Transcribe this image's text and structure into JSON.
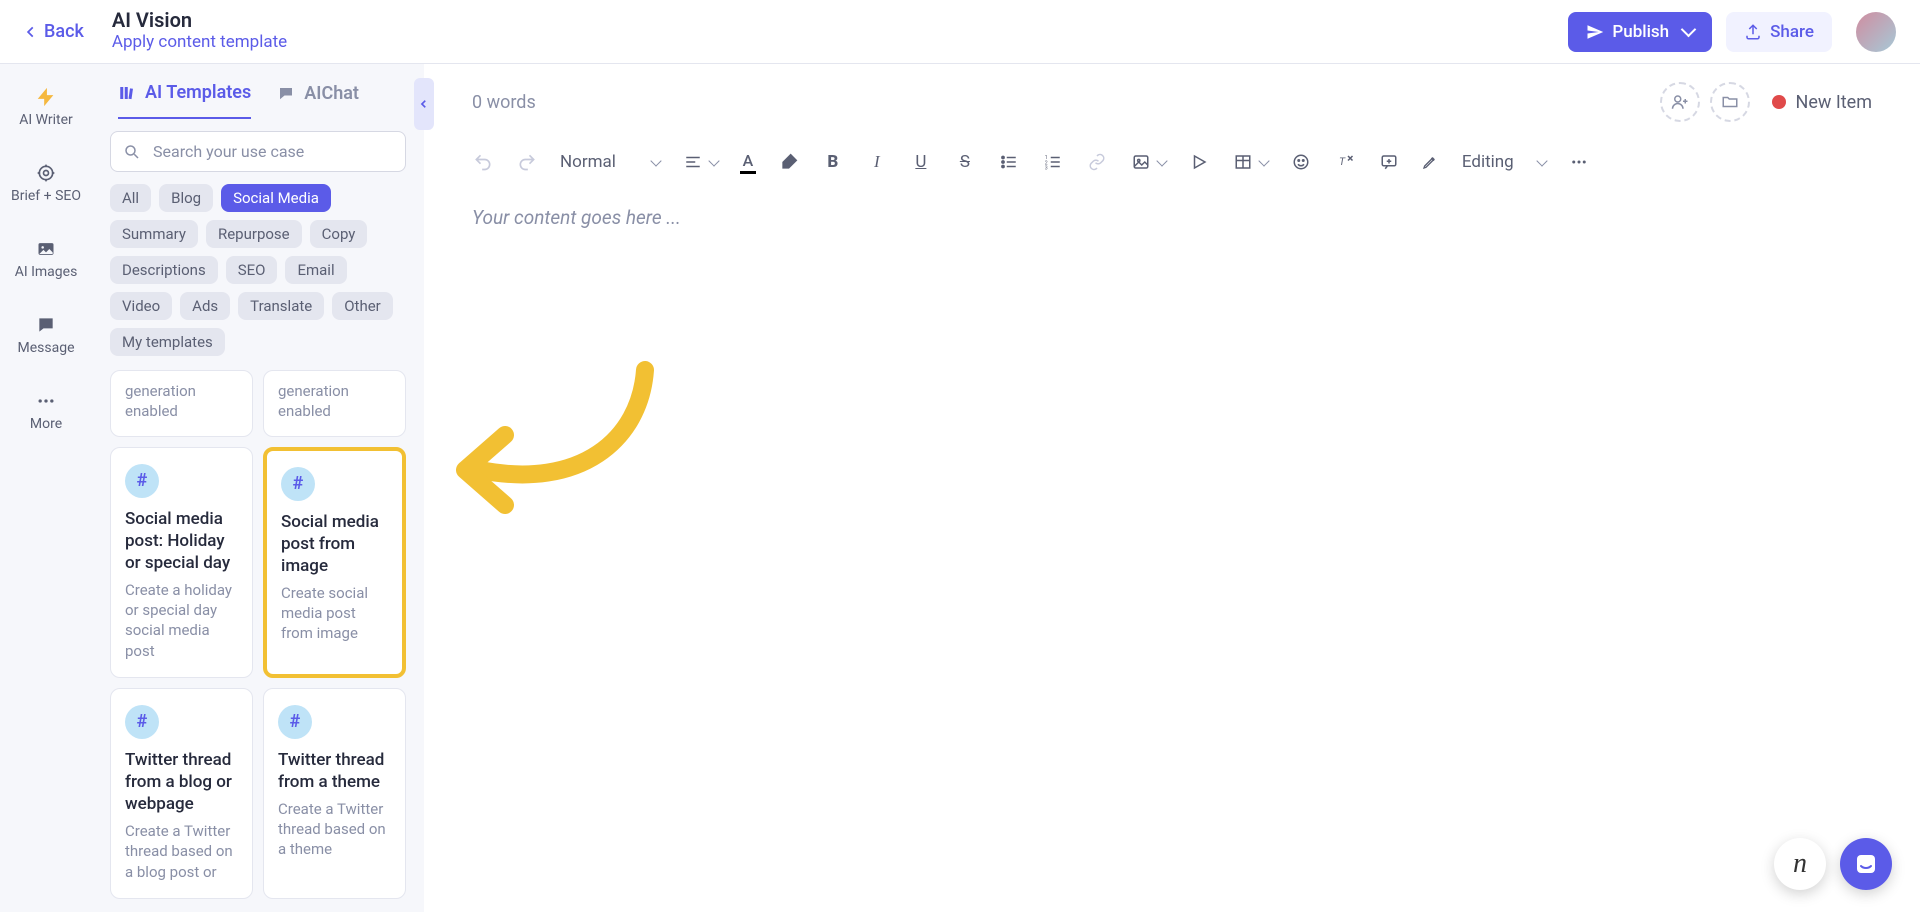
{
  "header": {
    "back": "Back",
    "title": "AI Vision",
    "subtitle": "Apply content template",
    "publish": "Publish",
    "share": "Share"
  },
  "leftnav": [
    {
      "label": "AI Writer",
      "icon": "bolt-icon"
    },
    {
      "label": "Brief + SEO",
      "icon": "target-icon"
    },
    {
      "label": "AI Images",
      "icon": "image-icon"
    },
    {
      "label": "Message",
      "icon": "message-icon"
    },
    {
      "label": "More",
      "icon": "dots-icon"
    }
  ],
  "sidebar": {
    "tabs": {
      "templates": "AI Templates",
      "chat": "AIChat"
    },
    "search_placeholder": "Search your use case",
    "chips": [
      "All",
      "Blog",
      "Social Media",
      "Summary",
      "Repurpose",
      "Copy",
      "Descriptions",
      "SEO",
      "Email",
      "Video",
      "Ads",
      "Translate",
      "Other",
      "My templates"
    ],
    "chips_active_index": 2,
    "templates": {
      "partial0": "generation enabled",
      "partial1": "generation enabled",
      "t0": {
        "title": "Social media post: Holiday or special day",
        "desc": "Create a holiday or special day social media post"
      },
      "t1": {
        "title": "Social media post from image",
        "desc": "Create social media post from image"
      },
      "t2": {
        "title": "Twitter thread from a blog or webpage",
        "desc": "Create a Twitter thread based on a blog post or"
      },
      "t3": {
        "title": "Twitter thread from a theme",
        "desc": "Create a Twitter thread based on a theme"
      }
    }
  },
  "editor": {
    "words": "0 words",
    "new_item": "New Item",
    "style_select": "Normal",
    "mode": "Editing",
    "placeholder": "Your content goes here ..."
  }
}
